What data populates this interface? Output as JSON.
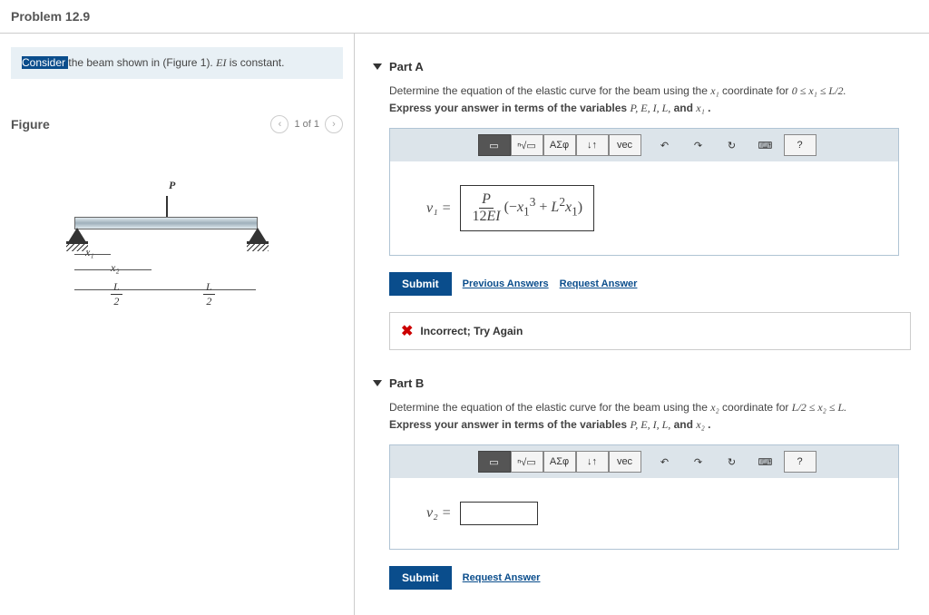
{
  "title": "Problem 12.9",
  "description": {
    "highlighted": "Consider ",
    "text1": "the beam shown in (Figure 1). ",
    "italic": "EI",
    "text2": " is constant."
  },
  "figure": {
    "label": "Figure",
    "pager": "1 of 1",
    "load": "P",
    "x1": "x₁",
    "x2": "x₂",
    "L1_num": "L",
    "L1_den": "2",
    "L2_num": "L",
    "L2_den": "2"
  },
  "toolbar": {
    "sigma": "ΑΣφ",
    "updown": "↓↑",
    "vec": "vec",
    "undo": "↶",
    "redo": "↷",
    "reset": "↻",
    "keyboard": "⌨",
    "help": "?"
  },
  "partA": {
    "title": "Part A",
    "prompt1": "Determine the equation of the elastic curve for the beam using the ",
    "coord": "x₁",
    "prompt2": " coordinate for ",
    "range": "0 ≤ x₁ ≤ L/2.",
    "express1": "Express your answer in terms of the variables ",
    "vars": "P, E, I, L,",
    "express2": " and ",
    "var_last": "x₁",
    "lhs": "v₁ =",
    "equation_raw": "P/(12EI) · (−x₁³ + L²x₁)",
    "submit": "Submit",
    "prev": "Previous Answers",
    "req": "Request Answer",
    "feedback": "Incorrect; Try Again"
  },
  "partB": {
    "title": "Part B",
    "prompt1": "Determine the equation of the elastic curve for the beam using the ",
    "coord": "x₂",
    "prompt2": " coordinate for ",
    "range": "L/2 ≤ x₂ ≤ L.",
    "express1": "Express your answer in terms of the variables ",
    "vars": "P, E, I, L,",
    "express2": " and ",
    "var_last": "x₂",
    "lhs": "v₂ =",
    "submit": "Submit",
    "req": "Request Answer"
  }
}
